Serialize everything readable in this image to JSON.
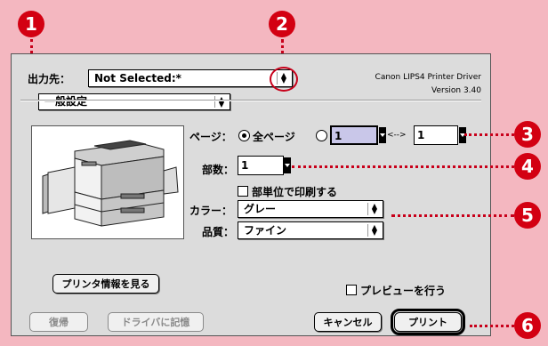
{
  "callouts": [
    "1",
    "2",
    "3",
    "4",
    "5",
    "6"
  ],
  "header": {
    "destination_label": "出力先：",
    "destination_value": "Not Selected:*",
    "driver_name": "Canon LIPS4 Printer Driver",
    "version": "Version 3.40"
  },
  "panel_selector": {
    "value": "一般設定"
  },
  "pages": {
    "label": "ページ：",
    "all_pages_label": "全ページ",
    "from_value": "1",
    "range_separator": "<-->",
    "to_value": "1"
  },
  "copies": {
    "label": "部数：",
    "value": "1",
    "collate_label": "部単位で印刷する"
  },
  "color": {
    "label": "カラー：",
    "value": "グレー"
  },
  "quality": {
    "label": "品質：",
    "value": "ファイン"
  },
  "buttons": {
    "printer_info": "プリンタ情報を見る",
    "restore": "復帰",
    "save_to_driver": "ドライバに記憶",
    "cancel": "キャンセル",
    "print": "プリント"
  },
  "preview_check_label": "プレビューを行う",
  "icons": {
    "popup_arrows": "up-down-arrows-icon",
    "printer": "printer-illustration"
  },
  "colors": {
    "background": "#f4b7c0",
    "callout": "#d30012",
    "selection": "#c9c7e9"
  }
}
